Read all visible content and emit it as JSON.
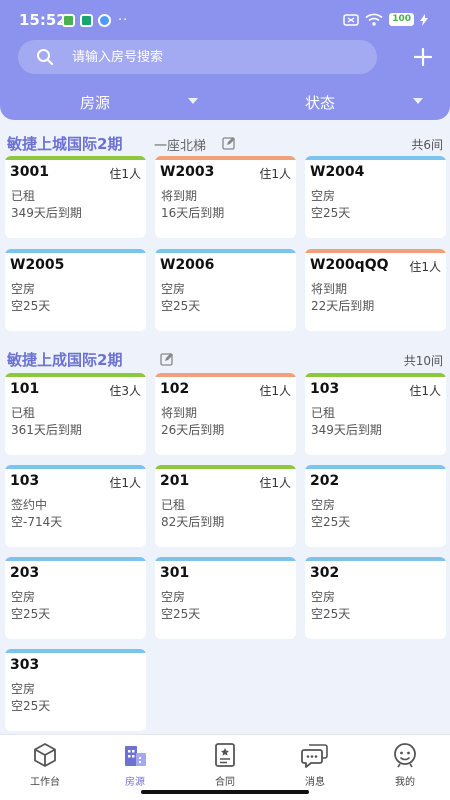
{
  "status": {
    "time": "15:52",
    "battery": "100"
  },
  "search": {
    "placeholder": "请输入房号搜索"
  },
  "filters": [
    {
      "label": "房源"
    },
    {
      "label": "状态"
    }
  ],
  "colors": {
    "header": "#8b93ee",
    "accent": "#6c72d4",
    "rented": "#8dc63f",
    "expiring": "#f0a07a",
    "vacant": "#7cc4ee"
  },
  "sections": [
    {
      "name": "敏捷上城国际2期",
      "floor": "一座北梯",
      "count": "共6间",
      "cards": [
        {
          "room": "3001",
          "occupants": "住1人",
          "status": "已租",
          "detail": "349天后到期",
          "color": "#8dc63f"
        },
        {
          "room": "W2003",
          "occupants": "住1人",
          "status": "将到期",
          "detail": "16天后到期",
          "color": "#f0a07a"
        },
        {
          "room": "W2004",
          "occupants": "",
          "status": "空房",
          "detail": "空25天",
          "color": "#7cc4ee"
        },
        {
          "room": "W2005",
          "occupants": "",
          "status": "空房",
          "detail": "空25天",
          "color": "#7cc4ee"
        },
        {
          "room": "W2006",
          "occupants": "",
          "status": "空房",
          "detail": "空25天",
          "color": "#7cc4ee"
        },
        {
          "room": "W200qQQ",
          "occupants": "住1人",
          "status": "将到期",
          "detail": "22天后到期",
          "color": "#f0a07a"
        }
      ]
    },
    {
      "name": "敏捷上成国际2期",
      "floor": "",
      "count": "共10间",
      "cards": [
        {
          "room": "101",
          "occupants": "住3人",
          "status": "已租",
          "detail": "361天后到期",
          "color": "#8dc63f"
        },
        {
          "room": "102",
          "occupants": "住1人",
          "status": "将到期",
          "detail": "26天后到期",
          "color": "#f0a07a"
        },
        {
          "room": "103",
          "occupants": "住1人",
          "status": "已租",
          "detail": "349天后到期",
          "color": "#8dc63f"
        },
        {
          "room": "103",
          "occupants": "住1人",
          "status": "签约中",
          "detail": "空-714天",
          "color": "#7cc4ee"
        },
        {
          "room": "201",
          "occupants": "住1人",
          "status": "已租",
          "detail": "82天后到期",
          "color": "#8dc63f"
        },
        {
          "room": "202",
          "occupants": "",
          "status": "空房",
          "detail": "空25天",
          "color": "#7cc4ee"
        },
        {
          "room": "203",
          "occupants": "",
          "status": "空房",
          "detail": "空25天",
          "color": "#7cc4ee"
        },
        {
          "room": "301",
          "occupants": "",
          "status": "空房",
          "detail": "空25天",
          "color": "#7cc4ee"
        },
        {
          "room": "302",
          "occupants": "",
          "status": "空房",
          "detail": "空25天",
          "color": "#7cc4ee"
        },
        {
          "room": "303",
          "occupants": "",
          "status": "空房",
          "detail": "空25天",
          "color": "#7cc4ee"
        }
      ]
    }
  ],
  "tabs": [
    {
      "label": "工作台",
      "icon": "cube-icon",
      "active": false
    },
    {
      "label": "房源",
      "icon": "building-icon",
      "active": true
    },
    {
      "label": "合同",
      "icon": "contract-icon",
      "active": false
    },
    {
      "label": "消息",
      "icon": "message-icon",
      "active": false
    },
    {
      "label": "我的",
      "icon": "profile-icon",
      "active": false
    }
  ]
}
